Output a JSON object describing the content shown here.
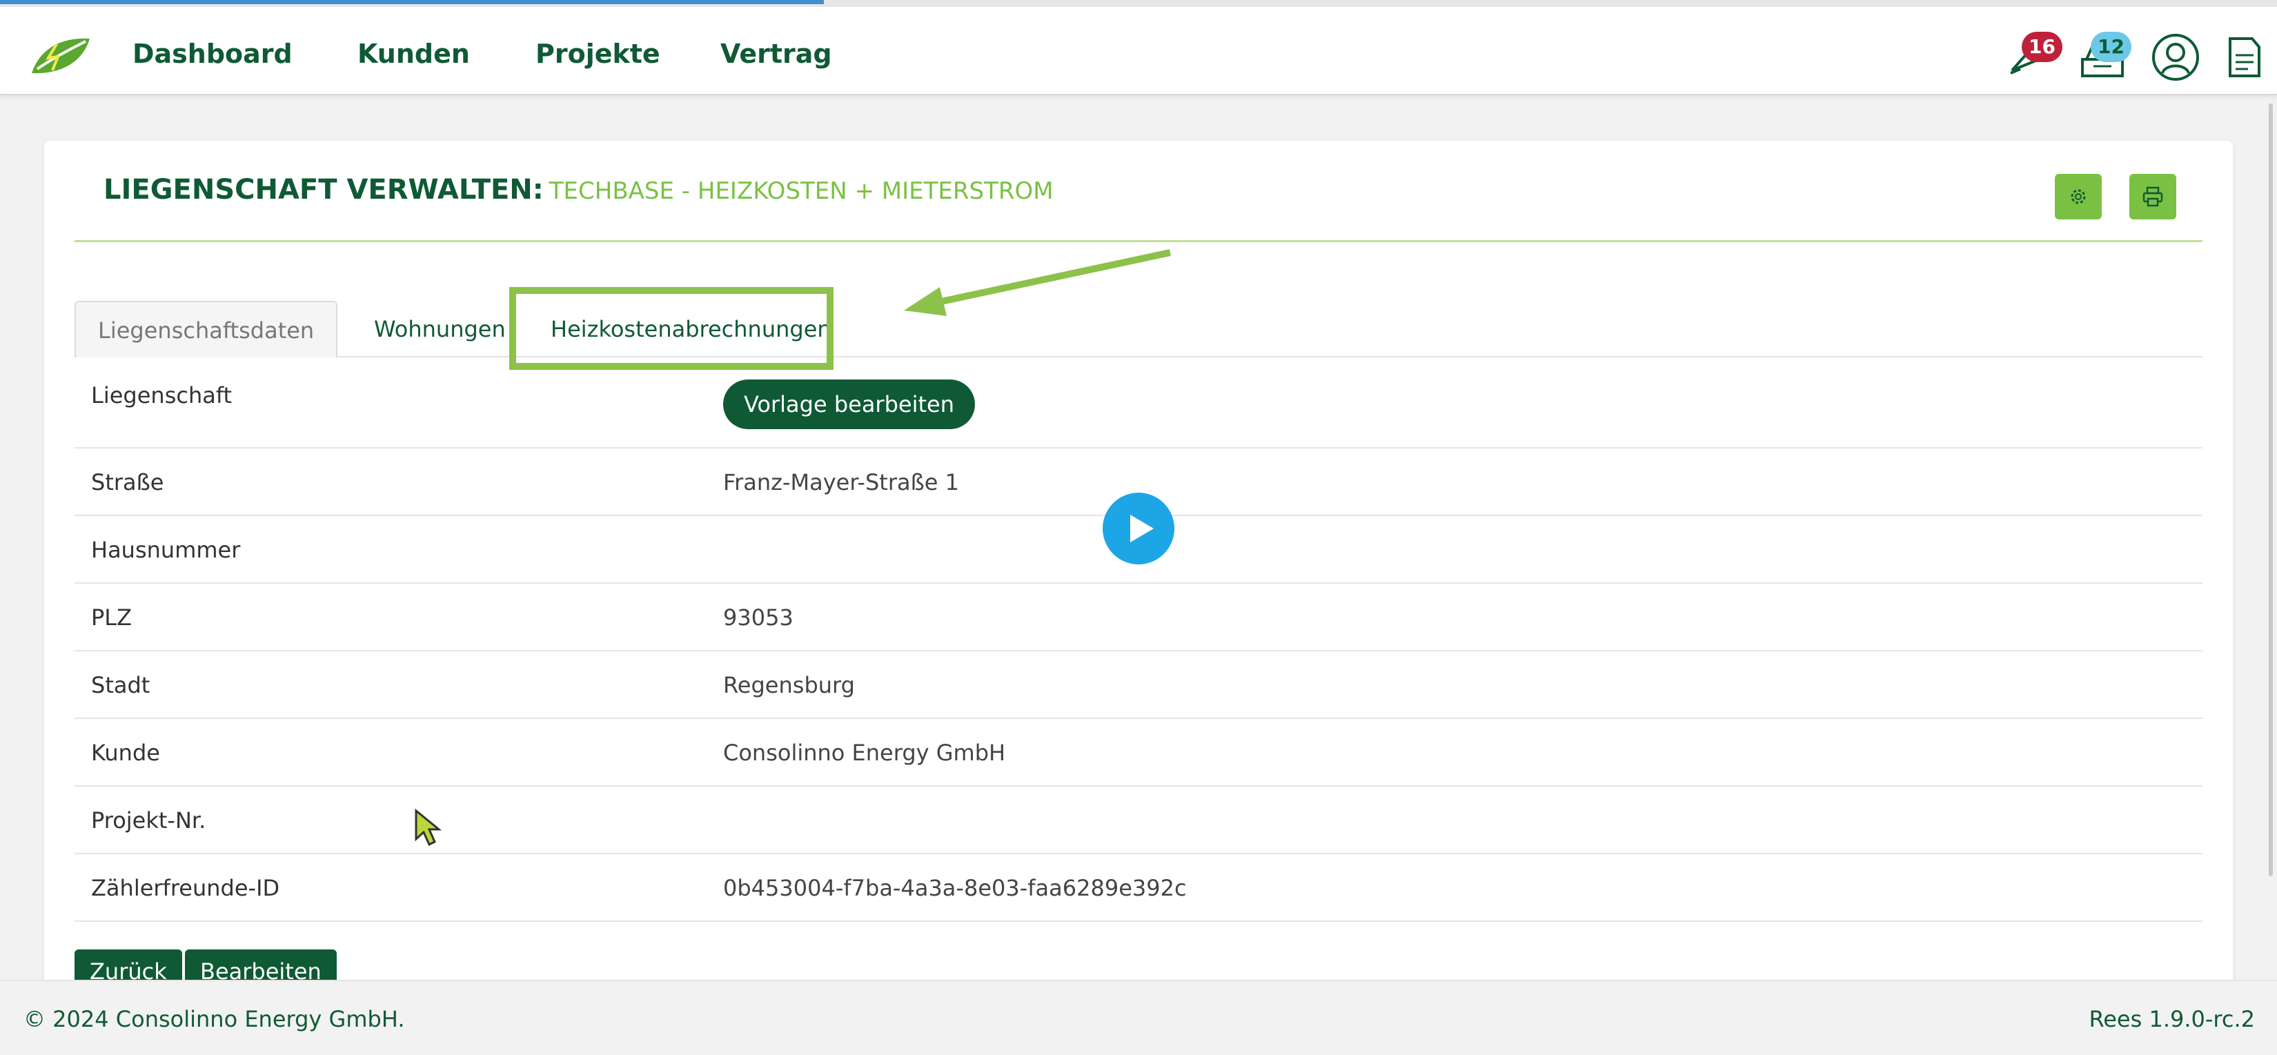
{
  "nav": {
    "items": [
      {
        "label": "Dashboard"
      },
      {
        "label": "Kunden"
      },
      {
        "label": "Projekte"
      },
      {
        "label": "Vertrag"
      }
    ],
    "notifications_count": "16",
    "messages_count": "12",
    "icons": [
      "leaf-logo-icon",
      "notification-bell-icon",
      "inbox-icon",
      "user-account-icon",
      "document-icon"
    ]
  },
  "card": {
    "title": "LIEGENSCHAFT VERWALTEN:",
    "subtitle": "TECHBASE - HEIZKOSTEN + MIETERSTROM",
    "icons": [
      "settings-gear-icon",
      "printer-icon"
    ]
  },
  "tabs": [
    {
      "label": "Liegenschaftsdaten",
      "active": true
    },
    {
      "label": "Wohnungen",
      "active": false
    },
    {
      "label": "Heizkostenabrechnungen",
      "active": false
    }
  ],
  "details": {
    "rows": [
      {
        "label": "Liegenschaft",
        "value": ""
      },
      {
        "label": "Straße",
        "value": "Franz-Mayer-Straße 1"
      },
      {
        "label": "Hausnummer",
        "value": ""
      },
      {
        "label": "PLZ",
        "value": "93053"
      },
      {
        "label": "Stadt",
        "value": "Regensburg"
      },
      {
        "label": "Kunde",
        "value": "Consolinno Energy GmbH"
      },
      {
        "label": "Projekt-Nr.",
        "value": ""
      },
      {
        "label": "Zählerfreunde-ID",
        "value": "0b453004-f7ba-4a3a-8e03-faa6289e392c"
      }
    ],
    "template_button": "Vorlage bearbeiten"
  },
  "actions": {
    "back": "Zurück",
    "edit": "Bearbeiten"
  },
  "footer": {
    "copyright": "© 2024 Consolinno Energy GmbH.",
    "version": "Rees 1.9.0-rc.2"
  },
  "colors": {
    "primary": "#0f5a35",
    "accent": "#7ac143",
    "highlight": "#8cc24a",
    "play": "#1da6e6",
    "badge_red": "#c0213a",
    "badge_blue": "#6cc9e6"
  }
}
